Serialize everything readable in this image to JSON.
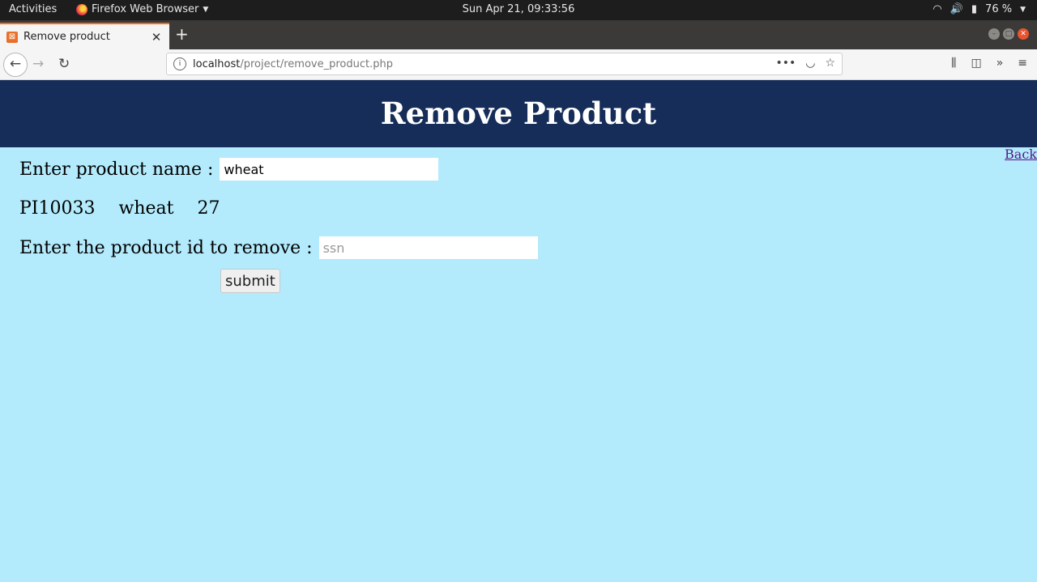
{
  "system": {
    "activities": "Activities",
    "app_name": "Firefox Web Browser",
    "clock": "Sun Apr 21, 09:33:56",
    "battery": "76 %"
  },
  "browser": {
    "tab_title": "Remove product",
    "url_host": "localhost",
    "url_path": "/project/remove_product.php"
  },
  "page": {
    "heading": "Remove Product",
    "back_link": "Back",
    "name_label": "Enter product name :",
    "name_value": "wheat",
    "result": {
      "id": "PI10033",
      "name": "wheat",
      "quantity": "27"
    },
    "id_label": "Enter the product id to remove :",
    "id_placeholder": "ssn",
    "submit_label": "submit"
  },
  "colors": {
    "header_bg": "#152d58",
    "page_bg": "#b3ebfc"
  }
}
